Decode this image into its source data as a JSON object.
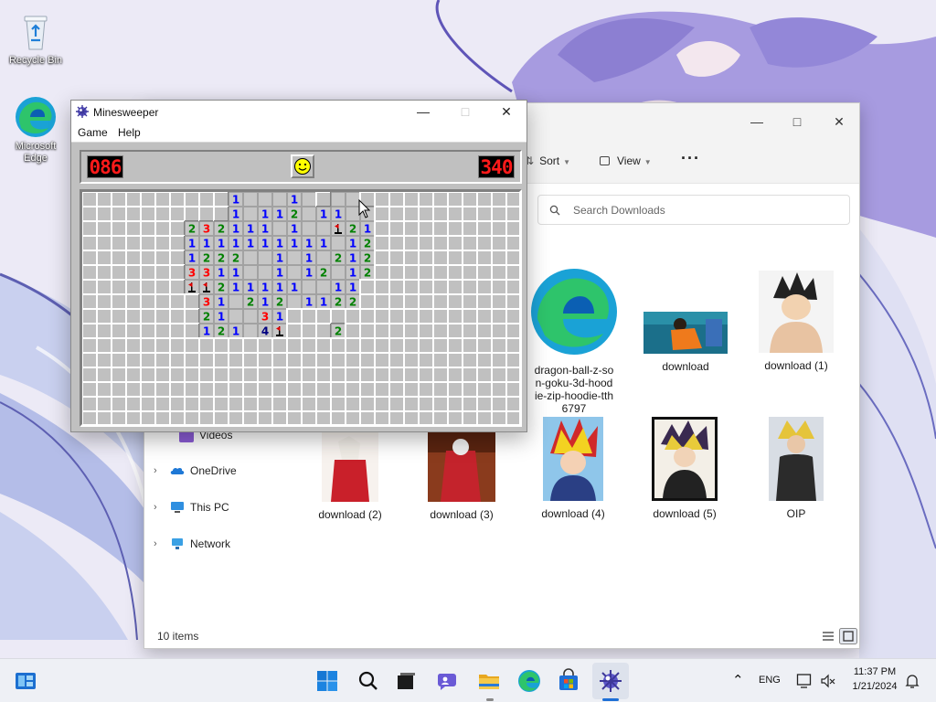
{
  "desktop": {
    "icons": [
      {
        "label": "Recycle Bin",
        "icon": "recycle-bin-icon"
      },
      {
        "label": "Microsoft Edge",
        "icon": "edge-icon"
      }
    ]
  },
  "explorer": {
    "toolbar": {
      "sort_label": "Sort",
      "view_label": "View",
      "more_label": "···"
    },
    "search": {
      "placeholder": "Search Downloads"
    },
    "nav": [
      {
        "label": "Videos",
        "icon": "videos-icon",
        "has_arrow": false
      },
      {
        "label": "OneDrive",
        "icon": "onedrive-icon",
        "has_arrow": true
      },
      {
        "label": "This PC",
        "icon": "this-pc-icon",
        "has_arrow": true
      },
      {
        "label": "Network",
        "icon": "network-icon",
        "has_arrow": true
      }
    ],
    "files": [
      {
        "name": "dragon-ball-z-son-goku-3d-hoodie-zip-hoodie-tth6797",
        "name_lines": [
          "dragon-ball-z-so",
          "n-goku-3d-hood",
          "ie-zip-hoodie-tth",
          "6797"
        ],
        "thumb": "edge-icon"
      },
      {
        "name": "download",
        "thumb": "image-thumbnail"
      },
      {
        "name": "download (1)",
        "thumb": "image-thumbnail"
      },
      {
        "name": "download (2)",
        "thumb": "image-thumbnail"
      },
      {
        "name": "download (3)",
        "thumb": "image-thumbnail"
      },
      {
        "name": "download (4)",
        "thumb": "image-thumbnail"
      },
      {
        "name": "download (5)",
        "thumb": "image-thumbnail"
      },
      {
        "name": "OIP",
        "thumb": "image-thumbnail"
      }
    ],
    "status": "10 items"
  },
  "minesweeper": {
    "title": "Minesweeper",
    "menu": [
      "Game",
      "Help"
    ],
    "mines_left": "086",
    "timer": "340",
    "smiley": "smiley-face-icon",
    "cols": 30,
    "rows": 16,
    "grid": [
      "##########1###1#1##11#########",
      "##########1#112#11##21########",
      "#######232111#1##!21##########",
      "#######1111111111#12##########",
      "#######1222##1#1#212##########",
      "#######3311##1#12#12##########",
      "#######!!211111##11###########",
      "########31#212#1122###########",
      "########21##31################",
      "########121#4!###2############",
      "##############################",
      "##############################",
      "##############################",
      "##############################",
      "##############################",
      "##############################"
    ],
    "revealed_mask": [
      "..........OOOOOO.OO...........",
      "..........OOOOOOOOOO..........",
      ".......OOOOOOOOOOOOO..........",
      ".......OOOOOOOOOOOOO..........",
      ".......OOOOOOOOOOOOO..........",
      ".......OOOOOOOOOOOOO..........",
      ".......OOOOOOOOOOOO...........",
      "........OOOOOOOOOOO...........",
      "........OOOOOO................",
      "........OOOOOO...O............",
      "..............................",
      "..............................",
      "..............................",
      "..............................",
      "..............................",
      ".............................."
    ],
    "number_colors": {
      "1": "#0000ff",
      "2": "#008000",
      "3": "#ff0000",
      "4": "#000080"
    }
  },
  "taskbar": {
    "pinned": [
      "widgets-icon",
      "start-icon",
      "search-icon",
      "task-view-icon",
      "chat-icon",
      "file-explorer-icon",
      "edge-icon",
      "store-icon",
      "minesweeper-icon"
    ],
    "language": "ENG",
    "time": "11:37 PM",
    "date": "1/21/2024"
  }
}
